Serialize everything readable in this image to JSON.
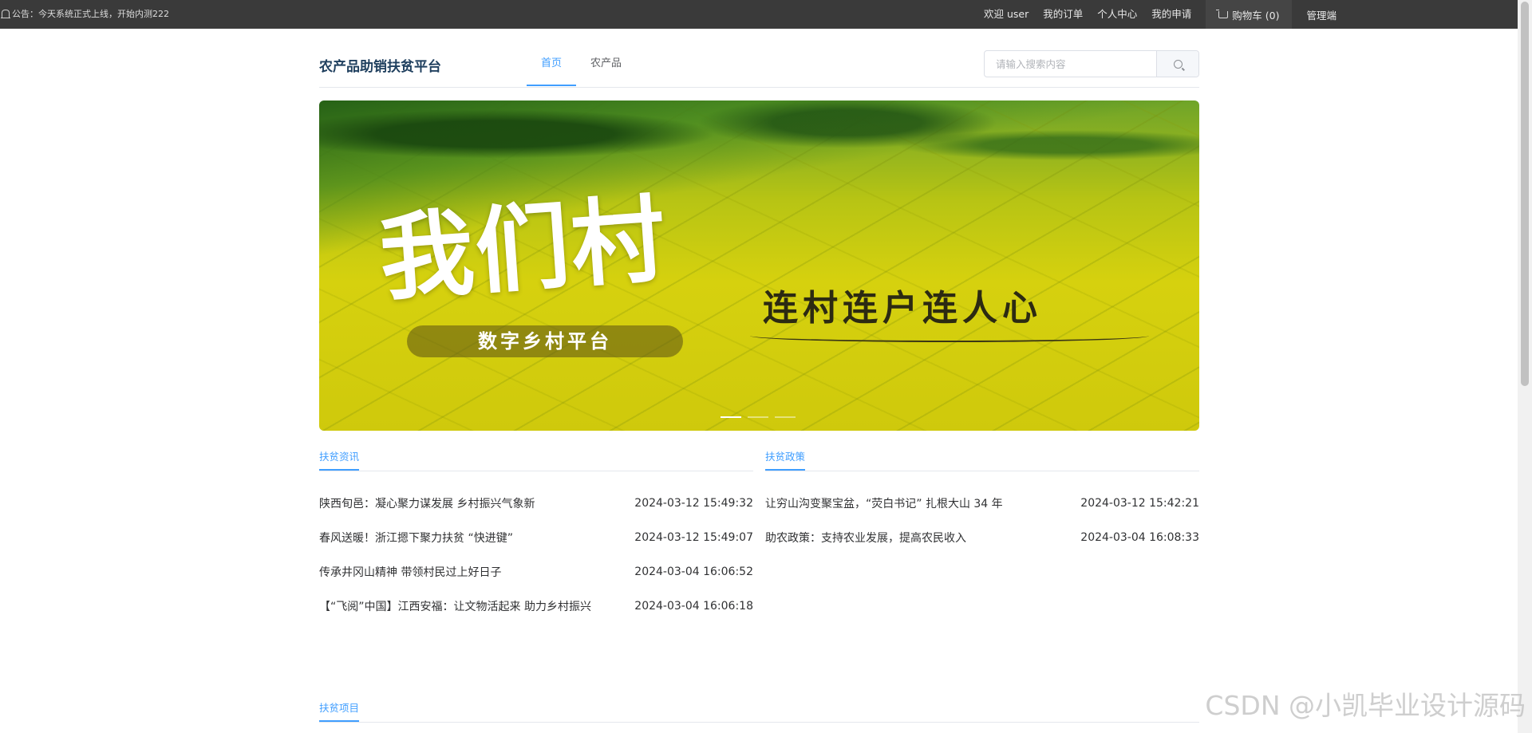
{
  "topbar": {
    "notice": "公告：今天系统正式上线，开始内测222",
    "welcome": "欢迎 user",
    "my_orders": "我的订单",
    "personal_center": "个人中心",
    "my_applications": "我的申请",
    "cart": "购物车 (0)",
    "admin": "管理端"
  },
  "header": {
    "site_title": "农产品助销扶贫平台",
    "tabs": [
      {
        "label": "首页",
        "active": true
      },
      {
        "label": "农产品",
        "active": false
      }
    ],
    "search_placeholder": "请输入搜索内容"
  },
  "banner": {
    "hero_text": "我们村",
    "pill_text": "数字乡村平台",
    "slogan": "连村连户连人心",
    "slides": 3,
    "active_slide": 1
  },
  "sections": {
    "news": {
      "title": "扶贫资讯",
      "items": [
        {
          "title": "陕西旬邑：凝心聚力谋发展 乡村振兴气象新",
          "date": "2024-03-12 15:49:32"
        },
        {
          "title": "春风送暖！浙江摁下聚力扶贫 “快进键”",
          "date": "2024-03-12 15:49:07"
        },
        {
          "title": "传承井冈山精神 带领村民过上好日子",
          "date": "2024-03-04 16:06:52"
        },
        {
          "title": "【“飞阅”中国】江西安福：让文物活起来 助力乡村振兴",
          "date": "2024-03-04 16:06:18"
        }
      ]
    },
    "policy": {
      "title": "扶贫政策",
      "items": [
        {
          "title": "让穷山沟变聚宝盆，“荧白书记” 扎根大山 34 年",
          "date": "2024-03-12 15:42:21"
        },
        {
          "title": "助农政策：支持农业发展，提高农民收入",
          "date": "2024-03-04 16:08:33"
        }
      ]
    },
    "projects": {
      "title": "扶贫项目"
    }
  },
  "watermark": "CSDN @小凯毕业设计源码",
  "colors": {
    "accent": "#409eff",
    "topbar": "#3a3a3a",
    "title": "#1f3f5e"
  }
}
